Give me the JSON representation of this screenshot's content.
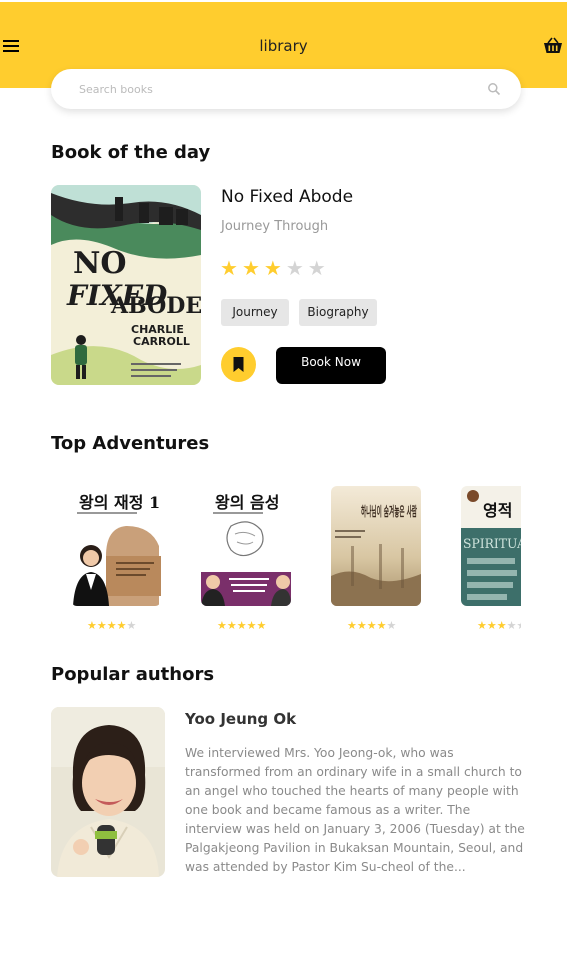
{
  "header": {
    "title": "library",
    "menu_icon": "hamburger-icon",
    "cart_icon": "basket-icon"
  },
  "search": {
    "placeholder": "Search books",
    "icon": "search-icon"
  },
  "book_of_day": {
    "section_title": "Book of the day",
    "cover_text": {
      "line1": "NO",
      "line2": "FIXED",
      "line3": "ABODE",
      "author_line1": "CHARLIE",
      "author_line2": "CARROLL"
    },
    "title": "No Fixed Abode",
    "subtitle": "Journey Through",
    "rating": 3,
    "rating_max": 5,
    "tags": [
      "Journey",
      "Biography"
    ],
    "bookmark_icon": "bookmark-icon",
    "cta_label": "Book Now"
  },
  "adventures": {
    "section_title": "Top Adventures",
    "items": [
      {
        "cover_title": "왕의 재정 1",
        "rating": 4
      },
      {
        "cover_title": "왕의 음성",
        "rating": 5
      },
      {
        "cover_title": "하나님이 숨겨놓은 사람",
        "rating": 4
      },
      {
        "cover_title": "영적",
        "cover_subtitle": "SPIRITUAL WARFARE",
        "rating": 3
      }
    ]
  },
  "authors": {
    "section_title": "Popular authors",
    "name": "Yoo Jeung Ok",
    "bio": "We interviewed Mrs. Yoo Jeong-ok, who was transformed from an ordinary wife in a small church to an angel who touched the hearts of many people with one book and became famous as a writer. The interview was held on January 3, 2006 (Tuesday) at the Palgakjeong Pavilion in Bukaksan Mountain, Seoul, and was attended by Pastor Kim Su-cheol of the..."
  },
  "colors": {
    "accent": "#ffcd2e",
    "star_off": "#d4d4d4",
    "button_dark": "#000000"
  }
}
